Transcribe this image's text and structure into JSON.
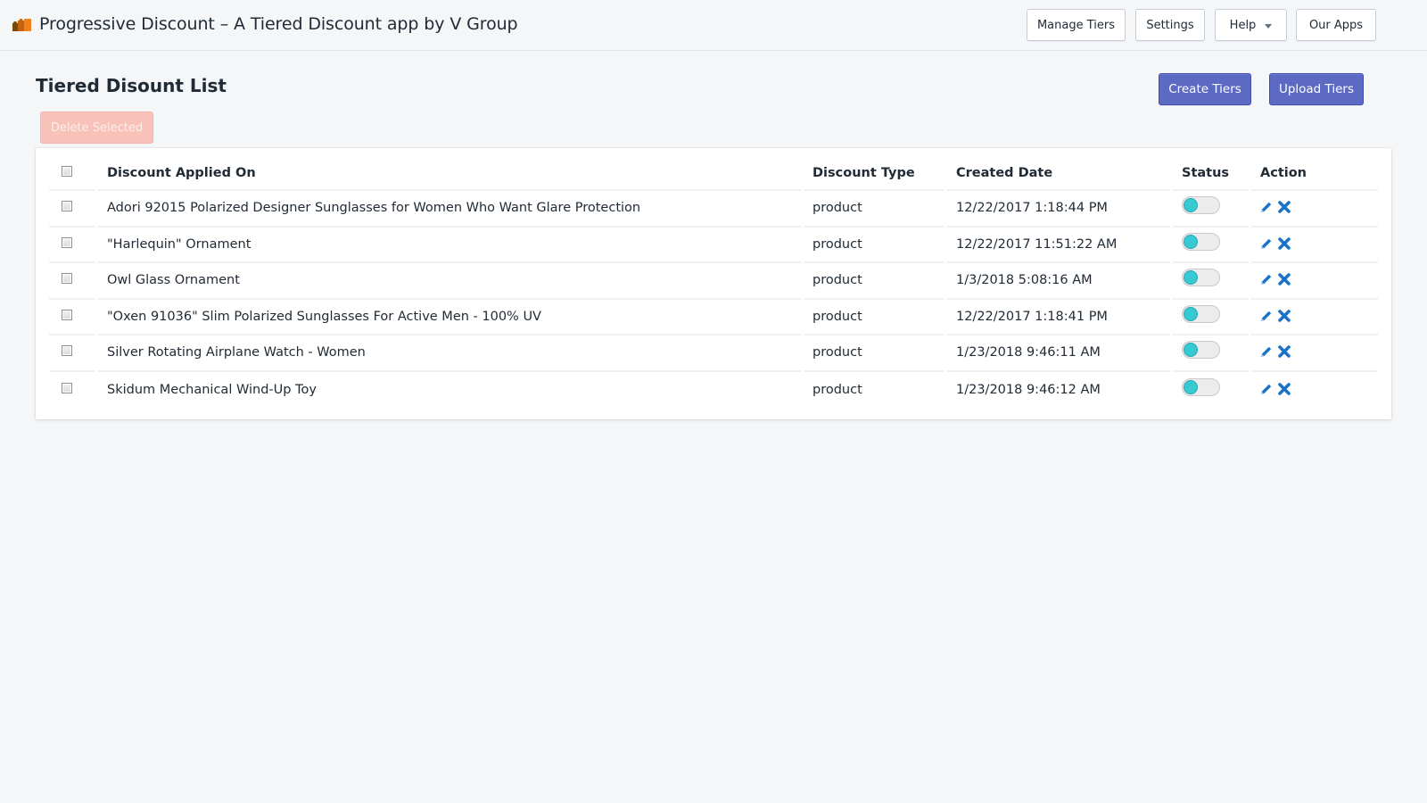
{
  "header": {
    "app_title": "Progressive Discount – A Tiered Discount app by V Group",
    "logo_icon": "bar-chart-logo-icon",
    "logo_colors": [
      "#7a4a05",
      "#c7620e",
      "#f0821e"
    ],
    "nav": {
      "manage_tiers": "Manage Tiers",
      "settings": "Settings",
      "help": "Help",
      "our_apps": "Our Apps"
    }
  },
  "page": {
    "title": "Tiered Disount List",
    "create_tiers": "Create Tiers",
    "upload_tiers": "Upload Tiers",
    "delete_selected": "Delete Selected",
    "accent_color": "#5c6ac4",
    "danger_disabled_color": "#f8c2b8"
  },
  "table": {
    "columns": {
      "applied_on": "Discount Applied On",
      "type": "Discount Type",
      "created": "Created Date",
      "status": "Status",
      "action": "Action"
    },
    "rows": [
      {
        "applied_on": "Adori 92015 Polarized Designer Sunglasses for Women Who Want Glare Protection",
        "type": "product",
        "created": "12/22/2017 1:18:44 PM",
        "status_on": false
      },
      {
        "applied_on": "\"Harlequin\" Ornament",
        "type": "product",
        "created": "12/22/2017 11:51:22 AM",
        "status_on": false
      },
      {
        "applied_on": "Owl Glass Ornament",
        "type": "product",
        "created": "1/3/2018 5:08:16 AM",
        "status_on": false
      },
      {
        "applied_on": "\"Oxen 91036\" Slim Polarized Sunglasses For Active Men - 100% UV",
        "type": "product",
        "created": "12/22/2017 1:18:41 PM",
        "status_on": false
      },
      {
        "applied_on": "Silver Rotating Airplane Watch - Women",
        "type": "product",
        "created": "1/23/2018 9:46:11 AM",
        "status_on": false
      },
      {
        "applied_on": "Skidum Mechanical Wind-Up Toy",
        "type": "product",
        "created": "1/23/2018 9:46:12 AM",
        "status_on": false
      }
    ],
    "icons": {
      "edit": "pencil-icon",
      "delete": "close-x-icon"
    },
    "icon_color": "#1a73c9",
    "toggle_knob_color": "#37c9d4"
  }
}
